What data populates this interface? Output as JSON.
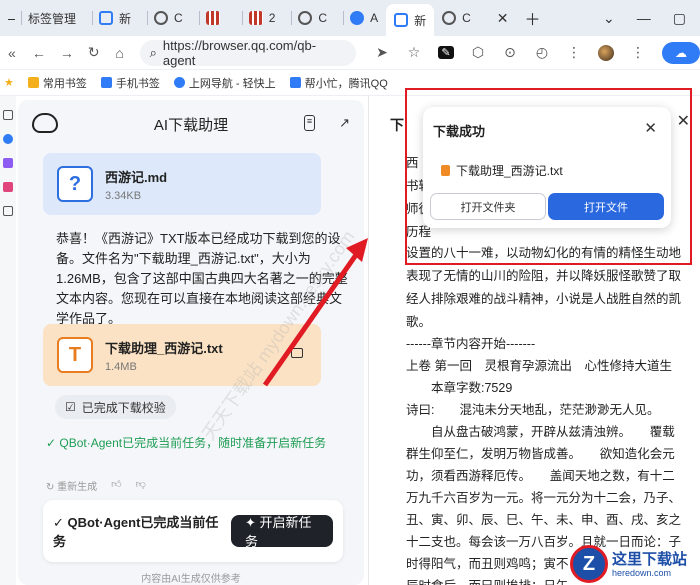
{
  "browser": {
    "tabs": [
      {
        "label": "标签管理",
        "color": "#8a93a6"
      },
      {
        "label": "新",
        "color": "#2f7cf6"
      },
      {
        "label": "C",
        "color": "#555"
      },
      {
        "label": "",
        "color": "#c0392b"
      },
      {
        "label": "2",
        "color": "#c0392b"
      },
      {
        "label": "C",
        "color": "#555"
      },
      {
        "label": "A",
        "color": "#2f7cf6"
      },
      {
        "label": "新",
        "color": "#2f7cf6"
      },
      {
        "label": "C",
        "color": "#555"
      }
    ],
    "url": "https://browser.qq.com/qb-agent",
    "bookmarks": [
      {
        "label": "常用书签",
        "color": "#f3b01c"
      },
      {
        "label": "手机书签",
        "color": "#2f7cf6"
      },
      {
        "label": "上网导航 - 轻快上",
        "color": "#2f7cf6"
      },
      {
        "label": "帮小忙，腾讯QQ",
        "color": "#2f7cf6"
      }
    ]
  },
  "agent": {
    "title": "AI下载助理",
    "file_md": {
      "name": "西游记.md",
      "size": "3.34KB"
    },
    "message": "恭喜！《西游记》TXT版本已经成功下载到您的设备。文件名为\"下载助理_西游记.txt\"，大小为1.26MB，包含了这部中国古典四大名著之一的完整文本内容。您现在可以直接在本地阅读这部经典文学作品了。",
    "file_txt": {
      "name": "下载助理_西游记.txt",
      "size": "1.4MB"
    },
    "verify_label": "已完成下载校验",
    "done_line": "✓ QBot·Agent已完成当前任务，随时准备开启新任务",
    "regen_label": "重新生成",
    "bottom_text": "✓ QBot·Agent已完成当前任务",
    "new_task_label": "✦ 开启新任务",
    "footnote": "内容由AI生成仅供参考"
  },
  "doc": {
    "title_char": "下",
    "lines": [
      "西",
      "书转",
      "师徒",
      "历程",
      "设置的八十一难，以动物幻化的有情的精怪生动地",
      "表现了无情的山川的险阻，并以降妖服怪歌赞了取",
      "经人排除艰难的战斗精神，小说是人战胜自然的凯",
      "歌。",
      "------章节内容开始-------",
      "上卷 第一回　灵根育孕源流出　心性修持大道生",
      "　　本章字数:7529",
      "诗曰:　　混沌未分天地乱，茫茫渺渺无人见。",
      "　　自从盘古破鸿蒙，开辟从兹清浊辨。　　覆载",
      "群生仰至仁，发明万物皆成善。　　欲知造化会元",
      "功，须看西游释厄传。　　盖闻天地之数，有十二",
      "万九千六百岁为一元。将一元分为十二会，乃子、",
      "丑、寅、卯、辰、巳、午、未、申、酉、戌、亥之",
      "十二支也。每会该一万八百岁。且就一日而论：子",
      "时得阳气，而丑则鸡鸣；寅不",
      "辰时食后，而巳则挨排；日午"
    ]
  },
  "toast": {
    "title": "下载成功",
    "file": "下载助理_西游记.txt",
    "open_folder": "打开文件夹",
    "open_file": "打开文件"
  },
  "watermark": "天天下载站 mydown.yesky.com",
  "logo": {
    "badge": "Z",
    "name": "这里下载站",
    "site": "heredown.com"
  }
}
